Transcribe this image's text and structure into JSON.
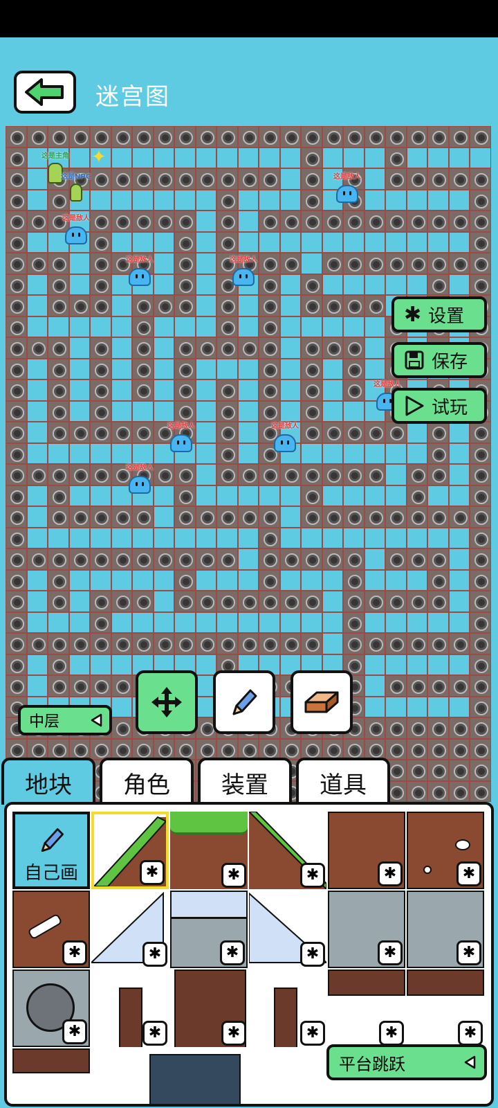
{
  "header": {
    "title": "迷宫图"
  },
  "maze": {
    "rows": [
      "WWWWWWWWWWWWWWWWWWWWWWW",
      "W.............W...W....",
      "W.WWWWWWWWWWW.W.W.WWWWW",
      "W.W.......W...W.W.....W",
      "WWW.WWWWW.W.WWWWWWWWWWW",
      "W...W...W.W...........W",
      "WWW.WWW.W.WWWW.WWWWWWWW",
      "W.W.W...W.W.W.W.....W.W",
      "W.WWW.WWW.W.W.WWWW..W.W",
      "W.....W...W.W.....W.W.W",
      "WWW.W.W.WWWWW.WWW.W.W.W",
      "W.W.W.W.W...W.W.W.W...W",
      "W.W.W.W.W.W.W.W.W.W.W.W",
      "W.W.W...W.W.W.W...W.W.W",
      "W.WWWWWWW.W.W.WWWWW.W.W",
      "W.........W.W.......W.W",
      "WWWWWWWWW.WWWWWWWW.WW.W",
      "W.W.....W.....W....W..W",
      "W.WWWWW.WWWWW.WWWWWWWWW",
      "W...........W.........W",
      "WWWWWWWWWWW.WWWWW.WWW.W",
      "W.W.....W...W...W...W.W",
      "W.W.WWW.WWWWWWW.WWWWW.W",
      "W...W...........W.....W",
      "WWWWWWWWWWWWWWW.WWWWWWW",
      "W.W.......W.....W.....W",
      "W.WWWWWWW.W.WWWWW.WWWWW",
      "W.......W.W.....W.....W",
      "WWWWWWWWWWWWWWWWWWWWWWW",
      "WWWWWWWWWWWWWWWWWWWWWWW",
      "WWWWWWWWWWWWWWWWWWWWWWW",
      "WWWWWWWWWWWWWWWWWWWWWWW"
    ]
  },
  "entities": {
    "hero_label": "这是主角",
    "npc_label": "这是NPC",
    "enemy_label": "这是敌人",
    "enemy_count": 8
  },
  "side_buttons": {
    "settings": "设置",
    "save": "保存",
    "play": "试玩"
  },
  "tools": {
    "move": "move-icon",
    "pencil": "pencil-icon",
    "eraser": "eraser-icon"
  },
  "layer": {
    "label": "中层"
  },
  "tabs": {
    "tiles": "地块",
    "characters": "角色",
    "devices": "装置",
    "items": "道具"
  },
  "palette": {
    "draw_yourself": "自己画",
    "category": "平台跳跃"
  },
  "colors": {
    "background": "#5ecbe3",
    "accent_green": "#6adf8e",
    "wall": "#7a6b66",
    "enemy_label": "#e03c3c"
  }
}
